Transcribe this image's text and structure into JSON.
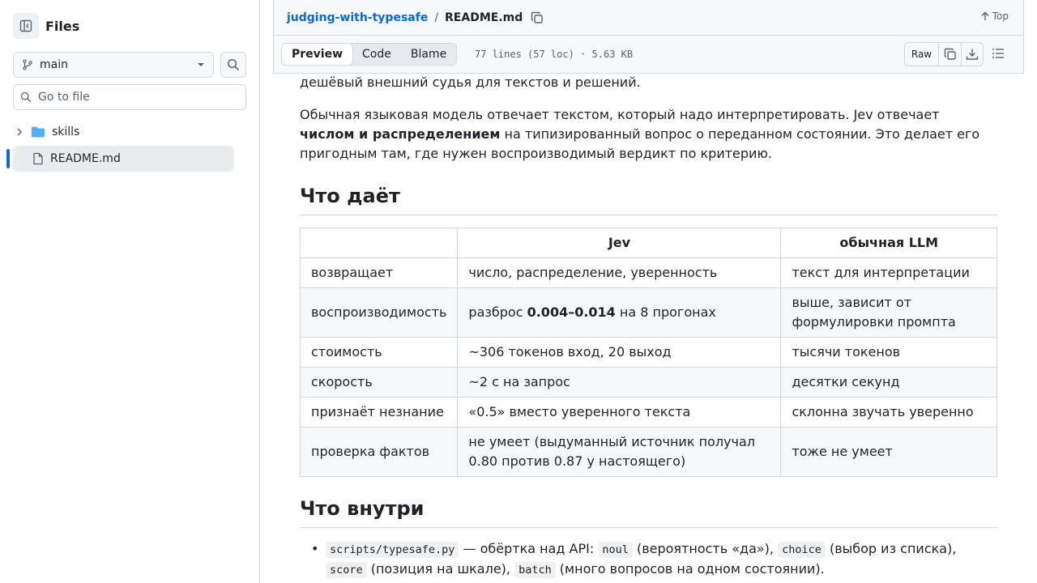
{
  "sidebar": {
    "title": "Files",
    "branch": "main",
    "goto_placeholder": "Go to file",
    "tree": [
      {
        "label": "skills",
        "type": "folder"
      },
      {
        "label": "README.md",
        "type": "file"
      }
    ]
  },
  "header": {
    "repo": "judging-with-typesafe",
    "sep": "/",
    "file": "README.md",
    "top_label": "Top"
  },
  "toolbar": {
    "tabs": [
      "Preview",
      "Code",
      "Blame"
    ],
    "meta": "77 lines (57 loc) · 5.63 KB",
    "raw_label": "Raw"
  },
  "article": {
    "p_cut": "дешёвый внешний судья для текстов и решений.",
    "p2_a": "Обычная языковая модель отвечает текстом, который надо интерпретировать. Jev отвечает ",
    "p2_b": "числом и распределением",
    "p2_c": " на типизированный вопрос о переданном состоянии. Это делает его пригодным там, где нужен воспроизводимый вердикт по критерию.",
    "h_gives": "Что даёт",
    "table": {
      "headers": [
        "",
        "Jev",
        "обычная LLM"
      ],
      "rows": [
        [
          "возвращает",
          "число, распределение, уверенность",
          "текст для интерпретации"
        ],
        [
          "воспроизводимость",
          "разброс ",
          "выше, зависит от формулировки промпта"
        ],
        [
          "стоимость",
          "~306 токенов вход, 20 выход",
          "тысячи токенов"
        ],
        [
          "скорость",
          "~2 с на запрос",
          "десятки секунд"
        ],
        [
          "признаёт незнание",
          "«0.5» вместо уверенного текста",
          "склонна звучать уверенно"
        ],
        [
          "проверка фактов",
          "не умеет (выдуманный источник получал 0.80 против 0.87 у настоящего)",
          "тоже не умеет"
        ]
      ],
      "repro_bold": "0.004–0.014",
      "repro_tail": " на 8 прогонах"
    },
    "h_inside": "Что внутри",
    "li": {
      "code1": "scripts/typesafe.py",
      "t1": " — обёртка над API: ",
      "code2": "noul",
      "t2": " (вероятность «да»), ",
      "code3": "choice",
      "t3": " (выбор из списка), ",
      "code4": "score",
      "t4": " (позиция на шкале), ",
      "code5": "batch",
      "t5": " (много вопросов на одном состоянии)."
    }
  }
}
